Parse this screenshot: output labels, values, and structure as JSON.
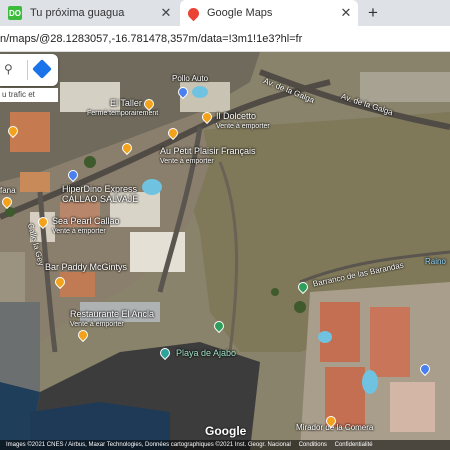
{
  "tabs": [
    {
      "title": "Tu próxima guagua",
      "icon": "green-app-icon",
      "color": "#3dbb3d"
    },
    {
      "title": "Google Maps",
      "icon": "google-maps-icon",
      "color": "#ea4335"
    }
  ],
  "new_tab_label": "+",
  "url": "n/maps/@28.1283057,-16.781478,357m/data=!3m1!1e3?hl=fr",
  "search": {
    "traffic_text": "u trafic et"
  },
  "map_labels": {
    "el_taller": "El Taller",
    "el_taller_sub": "Fermé temporairement",
    "pollo_auto": "Pollo Auto",
    "il_dolcetto": "Il Dolcetto",
    "il_dolcetto_sub": "Vente à emporter",
    "av_galga_1": "Av. de la Galga",
    "av_galga_2": "Av. de la Galga",
    "au_petit": "Au Petit Plaisir Français",
    "au_petit_sub": "Vente à emporter",
    "hiperdino_1": "HiperDino Express",
    "hiperdino_2": "CALLAO SALVAJE",
    "sea_pearl": "Sea Pearl Callao",
    "sea_pearl_sub": "Vente à emporter",
    "fana": "fana",
    "calle_gey": "Calle la Gey",
    "bar_paddy": "Bar Paddy McGintys",
    "restaurante": "Restaurante El Ancla",
    "restaurante_sub": "Vente à emporter",
    "playa": "Playa de Ajabo",
    "barranco": "Barranco de las Barandas",
    "mirador": "Mirador de la Comera",
    "raino": "Raino"
  },
  "google_logo": "Google",
  "footer": {
    "imagery": "Images ©2021 CNES / Airbus, Maxar Technologies, Données cartographiques ©2021 Inst. Geogr. Nacional",
    "terms": "Conditions",
    "privacy": "Confidentialité"
  }
}
